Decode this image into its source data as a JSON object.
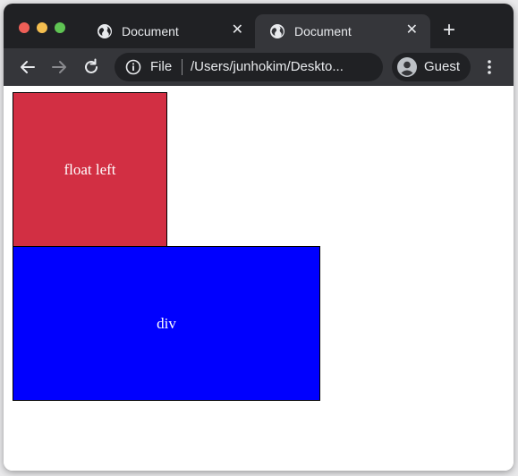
{
  "browser": {
    "tabs": [
      {
        "title": "Document",
        "icon": "globe-icon",
        "active": false
      },
      {
        "title": "Document",
        "icon": "globe-icon",
        "active": true
      }
    ],
    "new_tab_label": "+",
    "close_label": "✕",
    "omnibox": {
      "scheme": "File",
      "url": "/Users/junhokim/Deskto..."
    },
    "profile_name": "Guest",
    "colors": {
      "tabstrip": "#202124",
      "toolbar": "#35363a",
      "text": "#e8eaed"
    }
  },
  "page": {
    "float_box": {
      "text": "float left",
      "color": "#d22f43"
    },
    "div_box": {
      "text": "div",
      "color": "#0000ff"
    }
  }
}
